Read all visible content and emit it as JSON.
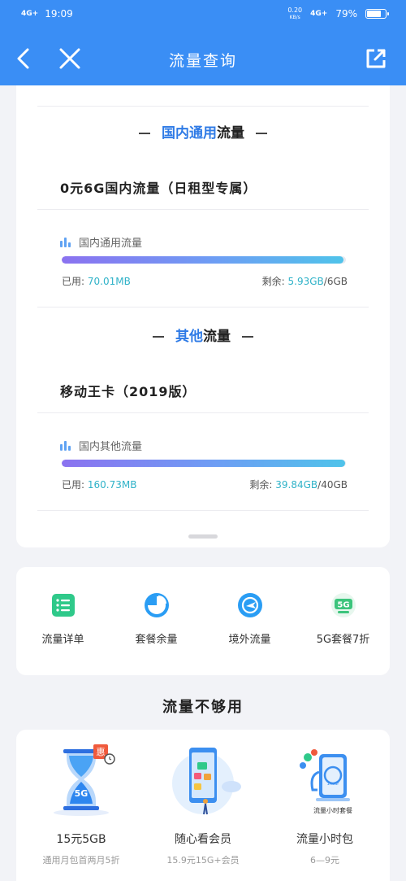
{
  "status_bar": {
    "network_left": "4G+",
    "time": "19:09",
    "speed_value": "0.20",
    "speed_unit": "KB/s",
    "network_right": "4G+",
    "battery_percent": "79%",
    "battery_level": 0.79
  },
  "header": {
    "title": "流量查询",
    "back_icon": "chevron-left-icon",
    "close_icon": "close-icon",
    "share_icon": "external-link-icon"
  },
  "sections": [
    {
      "heading_part1": "国内通用",
      "heading_part2": "流量",
      "package_name": "0元6G国内流量（日租型专属）",
      "scope_label": "国内通用流量",
      "used_label": "已用:",
      "used_value": "70.01MB",
      "remaining_label": "剩余:",
      "remaining_value": "5.93GB",
      "total": "/6GB",
      "bar_fill": 0.99
    },
    {
      "heading_part1": "其他",
      "heading_part2": "流量",
      "package_name": "移动王卡（2019版）",
      "scope_label": "国内其他流量",
      "used_label": "已用:",
      "used_value": "160.73MB",
      "remaining_label": "剩余:",
      "remaining_value": "39.84GB",
      "total": "/40GB",
      "bar_fill": 0.996
    }
  ],
  "shortcuts": [
    {
      "label": "流量详单",
      "icon": "list-icon",
      "color": "#2fc98a"
    },
    {
      "label": "套餐余量",
      "icon": "pie-chart-icon",
      "color": "#2a9df4"
    },
    {
      "label": "境外流量",
      "icon": "globe-plane-icon",
      "color": "#2a9df4"
    },
    {
      "label": "5G套餐7折",
      "icon": "5g-badge-icon",
      "color": "#3cc47c"
    }
  ],
  "promo_title": "流量不够用",
  "promos": [
    {
      "name": "15元5GB",
      "desc": "通用月包首两月5折",
      "art_text": "5G",
      "badge_text": "惠"
    },
    {
      "name": "随心看会员",
      "desc": "15.9元15G+会员",
      "art_text": ""
    },
    {
      "name": "流量小时包",
      "desc": "6—9元",
      "art_text": "1hour",
      "art_caption": "流量小时套餐"
    }
  ]
}
